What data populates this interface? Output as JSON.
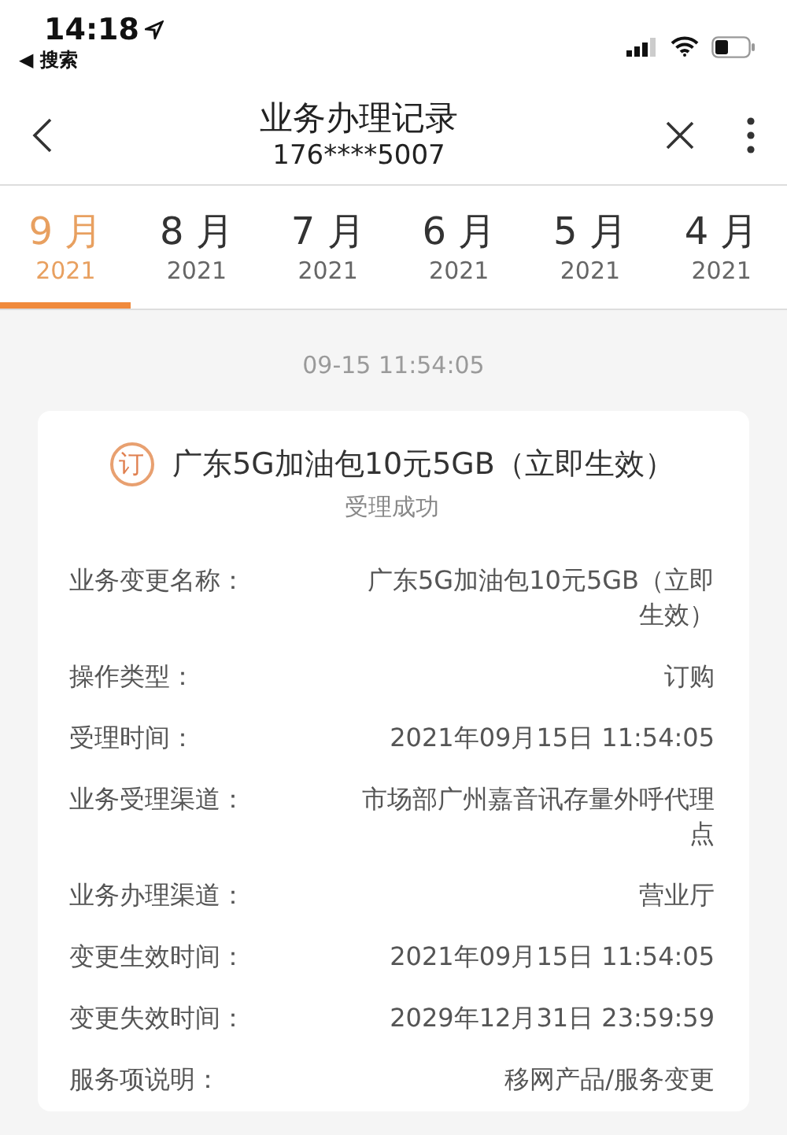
{
  "status_bar": {
    "time": "14:18",
    "back_app": "◀ 搜索"
  },
  "nav": {
    "title": "业务办理记录",
    "subtitle": "176****5007"
  },
  "tabs": [
    {
      "month": "9 月",
      "year": "2021",
      "selected": true
    },
    {
      "month": "8 月",
      "year": "2021",
      "selected": false
    },
    {
      "month": "7 月",
      "year": "2021",
      "selected": false
    },
    {
      "month": "6 月",
      "year": "2021",
      "selected": false
    },
    {
      "month": "5 月",
      "year": "2021",
      "selected": false
    },
    {
      "month": "4 月",
      "year": "2021",
      "selected": false
    }
  ],
  "timestamp": "09-15 11:54:05",
  "record": {
    "badge": "订",
    "title": "广东5G加油包10元5GB（立即生效）",
    "status": "受理成功",
    "fields": [
      {
        "label": "业务变更名称：",
        "value": "广东5G加油包10元5GB（立即生效）"
      },
      {
        "label": "操作类型：",
        "value": "订购"
      },
      {
        "label": "受理时间：",
        "value": "2021年09月15日 11:54:05"
      },
      {
        "label": "业务受理渠道：",
        "value": "市场部广州嘉音讯存量外呼代理点"
      },
      {
        "label": "业务办理渠道：",
        "value": "营业厅"
      },
      {
        "label": "变更生效时间：",
        "value": "2021年09月15日 11:54:05"
      },
      {
        "label": "变更失效时间：",
        "value": "2029年12月31日 23:59:59"
      },
      {
        "label": "服务项说明：",
        "value": "移网产品/服务变更"
      }
    ]
  }
}
